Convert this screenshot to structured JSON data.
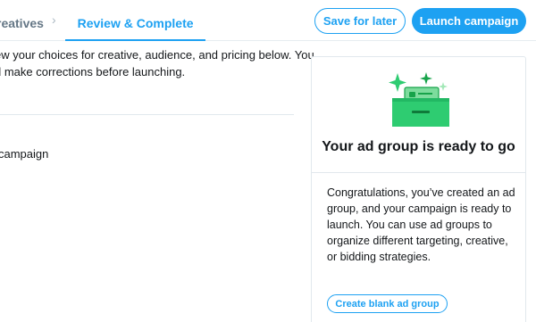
{
  "header": {
    "steps": [
      {
        "label": "reatives",
        "state": "previous"
      },
      {
        "label": "Review & Complete",
        "state": "active"
      }
    ],
    "separator": "›",
    "save_label": "Save for later",
    "launch_label": "Launch campaign"
  },
  "main": {
    "intro_lines": [
      "ew your choices for creative, audience, and pricing below. You",
      "d make corrections before launching."
    ],
    "campaign_text": "campaign"
  },
  "card": {
    "illustration": "ad-group-tray-icon",
    "title": "Your ad group is ready to go",
    "body_lines": [
      "Congratulations, you’ve created an ad",
      "group, and your campaign is ready to",
      "launch. You can use ad groups to",
      "organize different targeting, creative,",
      "or bidding strategies."
    ],
    "create_button_label": "Create blank ad group"
  },
  "colors": {
    "accent": "#1da1f2",
    "illustration_green": "#2ecc71",
    "illustration_dark_green": "#17a34a"
  }
}
